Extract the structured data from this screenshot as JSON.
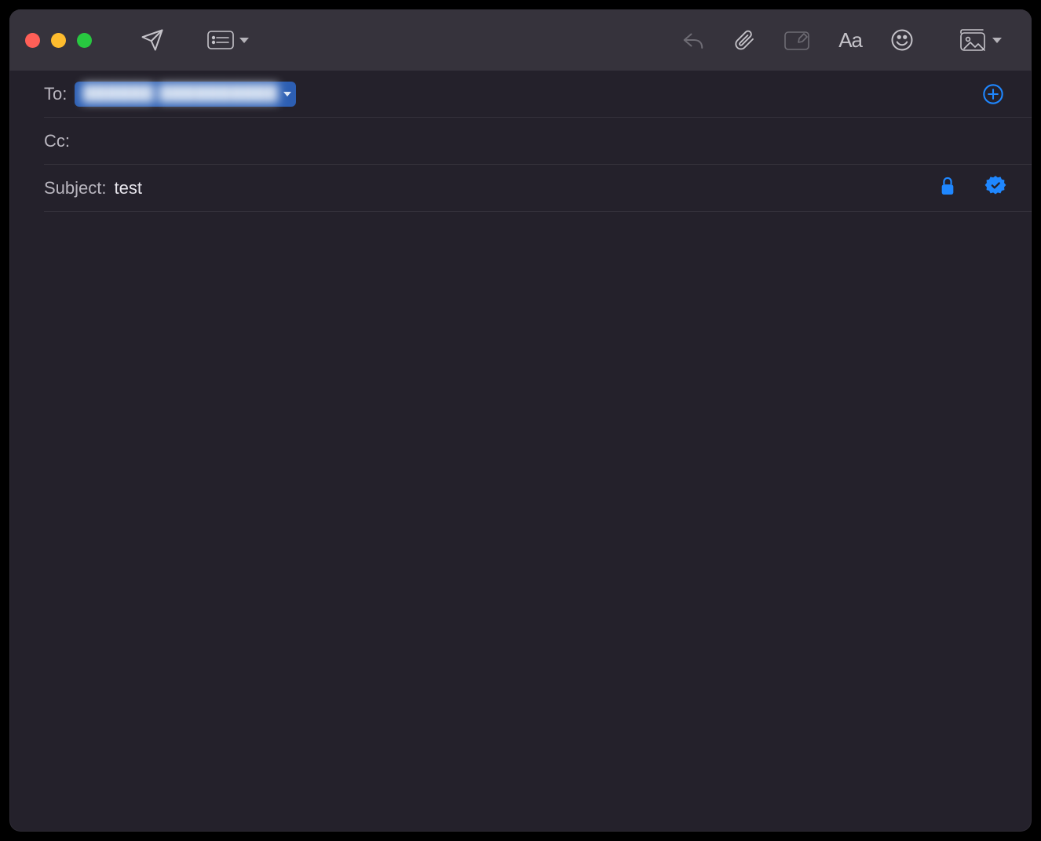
{
  "toolbar": {
    "send_icon": "send",
    "header_fields_icon": "header-fields",
    "reply_icon": "reply",
    "attach_icon": "attachment",
    "markup_icon": "markup",
    "format_icon": "format-Aa",
    "emoji_icon": "emoji",
    "photo_icon": "photo-browser"
  },
  "fields": {
    "to_label": "To:",
    "to_recipient": "██████ ██████████",
    "cc_label": "Cc:",
    "cc_value": "",
    "subject_label": "Subject:",
    "subject_value": "test"
  },
  "security": {
    "encrypt_icon": "encrypt-lock",
    "sign_icon": "sign-seal"
  },
  "body": "",
  "colors": {
    "accent": "#1f87ff",
    "chip": "#2d5fb3",
    "window_bg": "#24212b",
    "titlebar_bg": "#36333c"
  }
}
